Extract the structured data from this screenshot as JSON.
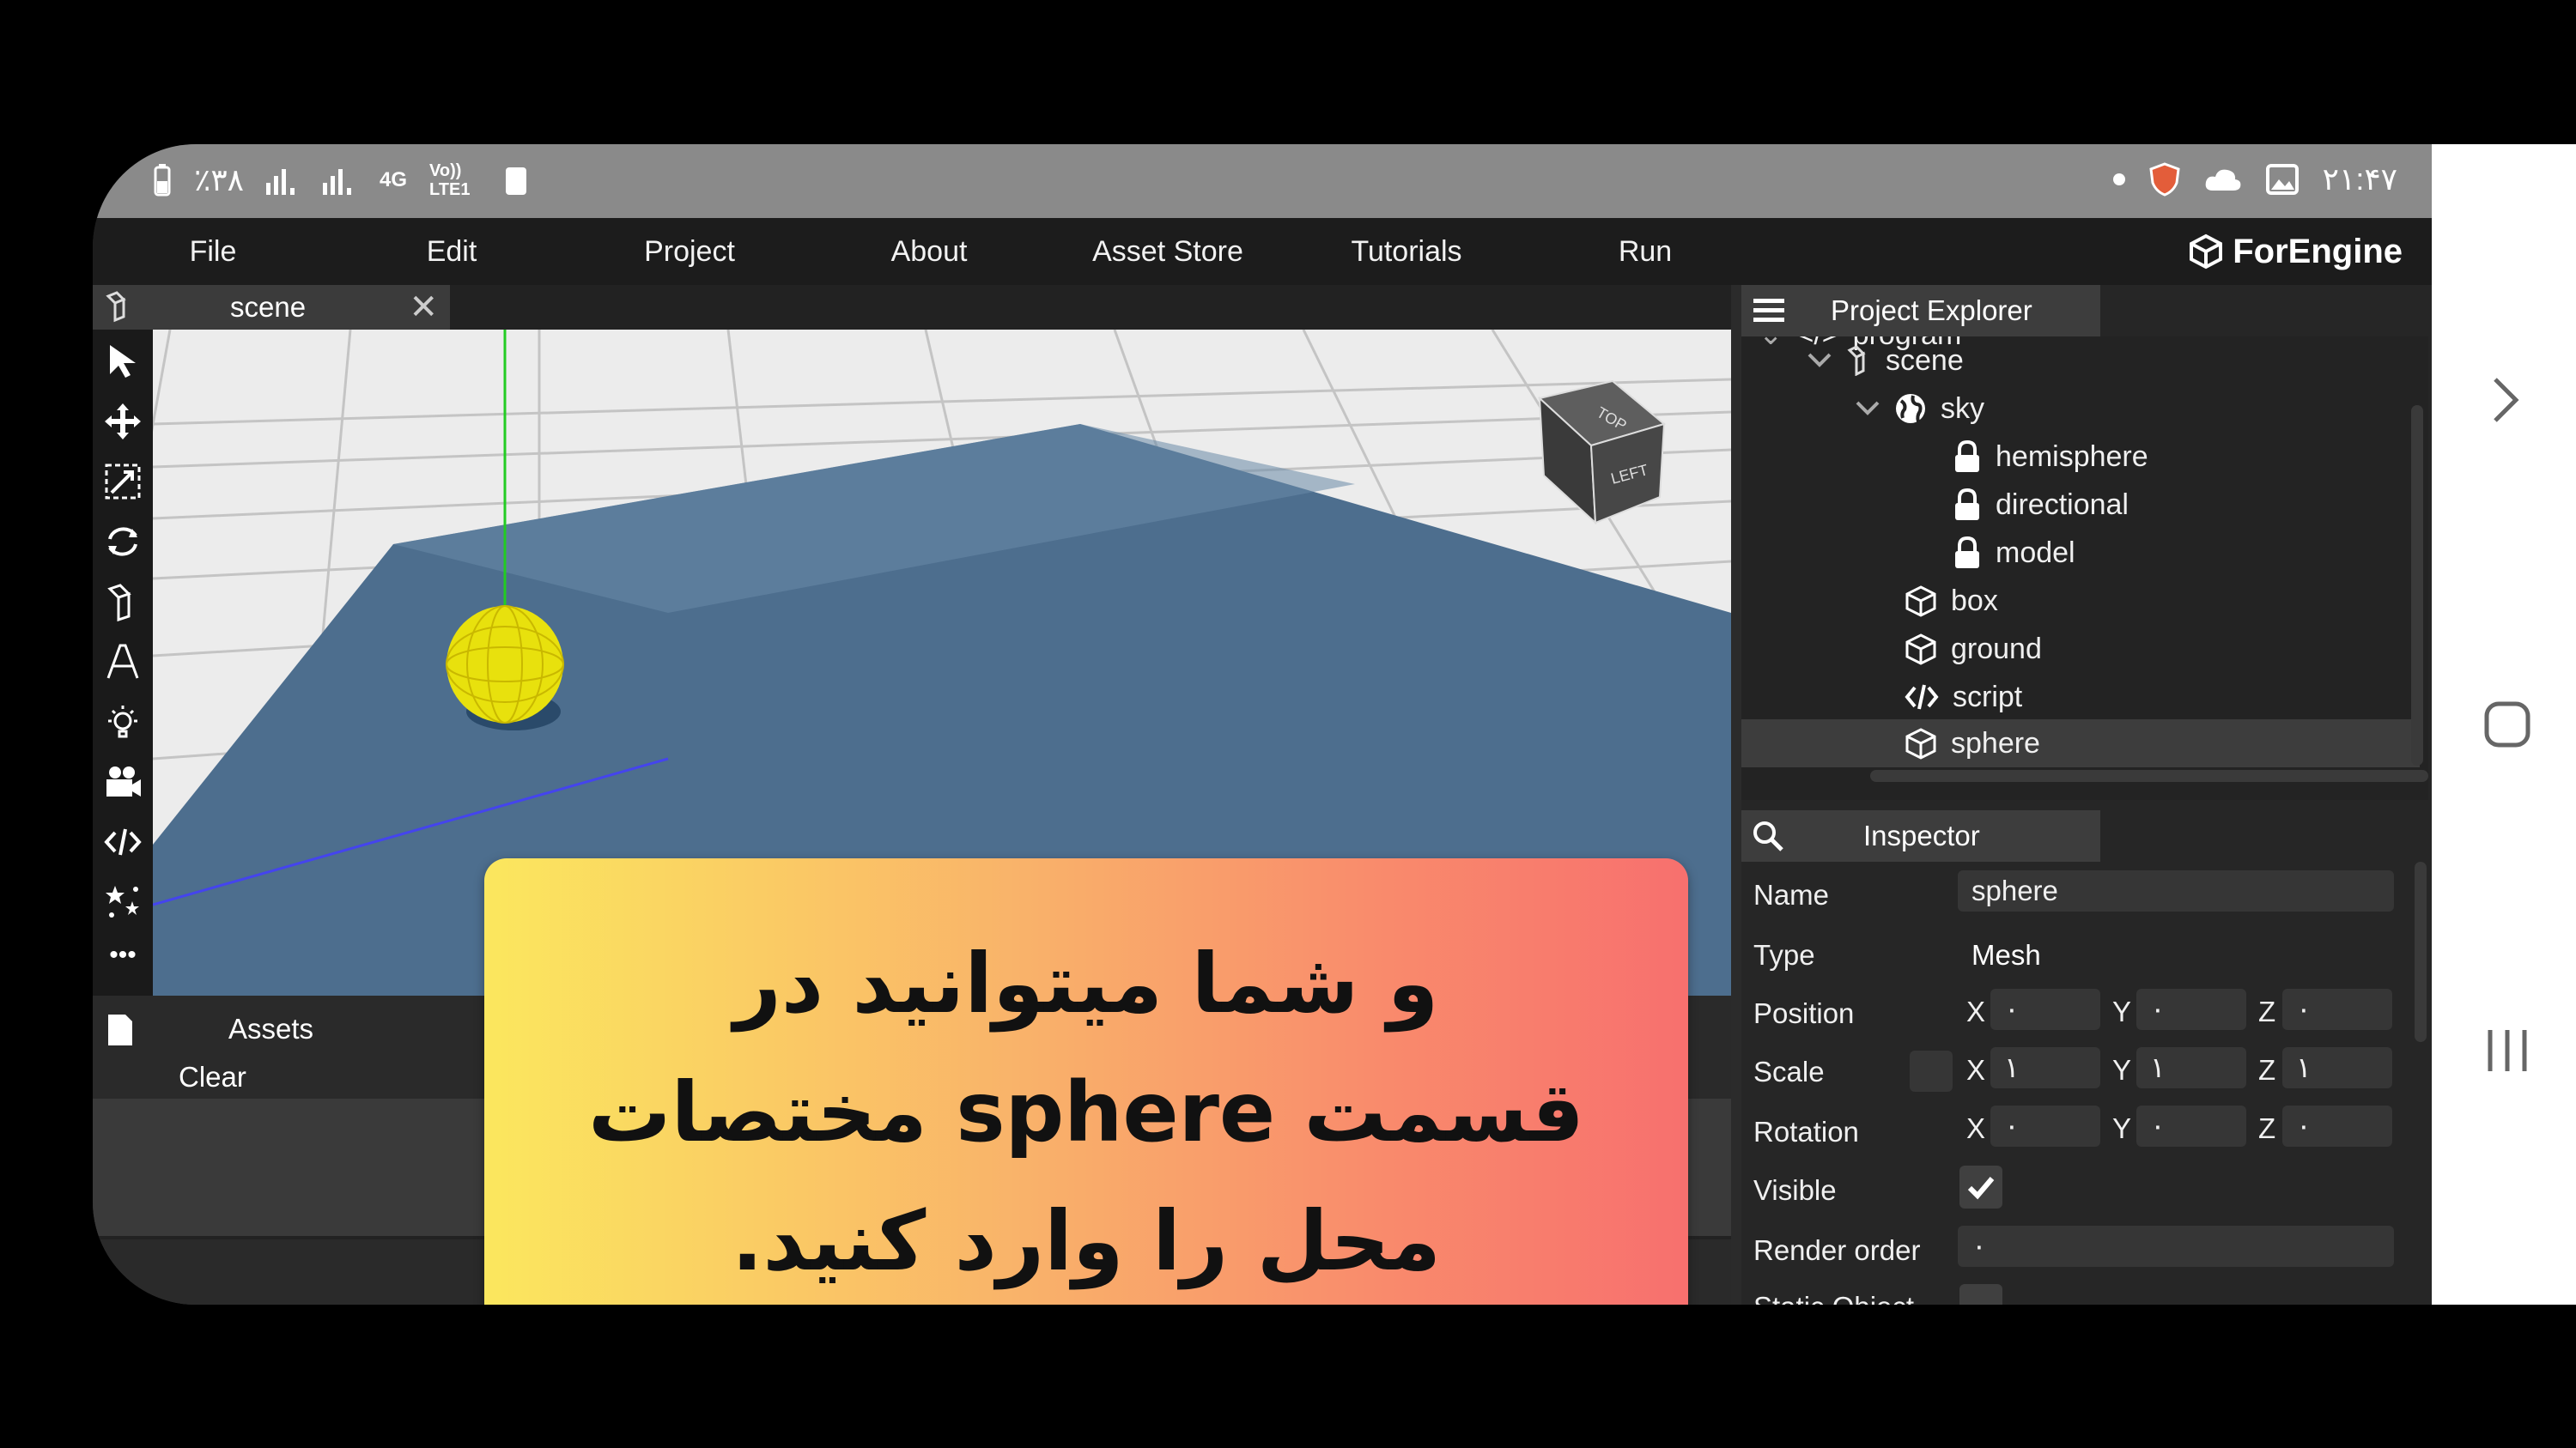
{
  "status_bar": {
    "left": [
      "٪۳۸",
      "4G",
      "Vo)) LTE1"
    ],
    "time": "۲۱:۴۷"
  },
  "menu": [
    "File",
    "Edit",
    "Project",
    "About",
    "Asset Store",
    "Tutorials",
    "Run"
  ],
  "brand": "ForEngine",
  "scene_tab": {
    "label": "scene"
  },
  "tools": [
    "select-arrow-icon",
    "move-icon",
    "scale-icon",
    "rotate-icon",
    "object-icon",
    "text-icon",
    "light-icon",
    "camera-icon",
    "code-icon",
    "particles-icon",
    "more-icon"
  ],
  "viewport": {
    "cube_labels": [
      "TOP",
      "LEFT"
    ],
    "view_mode": "3D"
  },
  "assets": {
    "tab_label": "Assets",
    "clear_label": "Clear"
  },
  "project_explorer": {
    "title": "Project Explorer",
    "items": [
      {
        "label": "program",
        "icon": "code-icon"
      },
      {
        "label": "scene",
        "icon": "scene-icon"
      },
      {
        "label": "sky",
        "icon": "globe-icon"
      },
      {
        "label": "hemisphere",
        "icon": "lock-icon"
      },
      {
        "label": "directional",
        "icon": "lock-icon"
      },
      {
        "label": "model",
        "icon": "lock-icon"
      },
      {
        "label": "box",
        "icon": "cube-icon"
      },
      {
        "label": "ground",
        "icon": "cube-icon"
      },
      {
        "label": "script",
        "icon": "code-icon"
      },
      {
        "label": "sphere",
        "icon": "cube-icon",
        "selected": true
      }
    ]
  },
  "inspector": {
    "title": "Inspector",
    "name_label": "Name",
    "name_value": "sphere",
    "type_label": "Type",
    "type_value": "Mesh",
    "position_label": "Position",
    "position": [
      "۰",
      "۰",
      "۰"
    ],
    "scale_label": "Scale",
    "scale": [
      "۱",
      "۱",
      "۱"
    ],
    "rotation_label": "Rotation",
    "rotation": [
      "۰",
      "۰",
      "۰"
    ],
    "visible_label": "Visible",
    "visible": true,
    "render_order_label": "Render order",
    "render_order": "۰",
    "static_label": "Static Object",
    "axes": [
      "X",
      "Y",
      "Z"
    ]
  },
  "overlay": {
    "line1": "و شما میتوانید در",
    "line2": "قسمت sphere مختصات",
    "line3": "محل را وارد کنید."
  },
  "colors": {
    "ground": "#4d6e8e",
    "sphere": "#e8e10d",
    "overlay_start": "#fbe75e",
    "overlay_end": "#f7706e"
  }
}
